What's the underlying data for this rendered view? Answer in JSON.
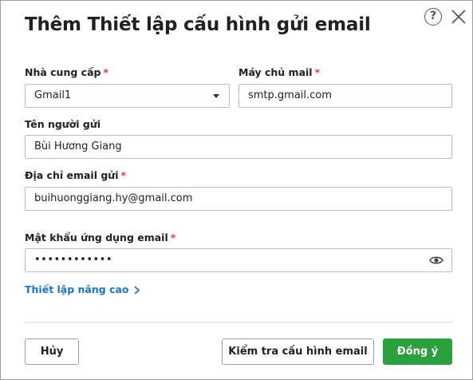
{
  "dialog": {
    "title": "Thêm Thiết lập cấu hình gửi email",
    "help_glyph": "?",
    "icons": {
      "help": "help-circle-icon",
      "close": "close-icon"
    }
  },
  "form": {
    "required_mark": "*",
    "provider": {
      "label": "Nhà cung cấp",
      "value": "Gmail1"
    },
    "mail_server": {
      "label": "Máy chủ mail",
      "value": "smtp.gmail.com"
    },
    "sender_name": {
      "label": "Tên người gửi",
      "value": "Bùi Hương Giang"
    },
    "sender_email": {
      "label": "Địa chỉ email gửi",
      "value": "buihuonggiang.hy@gmail.com"
    },
    "app_password": {
      "label": "Mật khẩu ứng dụng email",
      "value": "••••••••••••"
    },
    "advanced_link": "Thiết lập nâng cao"
  },
  "footer": {
    "cancel_label": "Hủy",
    "test_label": "Kiểm tra cấu hình email",
    "ok_label": "Đồng ý"
  },
  "colors": {
    "primary": "#2aa13d",
    "link": "#1976d2",
    "required": "#e53935"
  }
}
